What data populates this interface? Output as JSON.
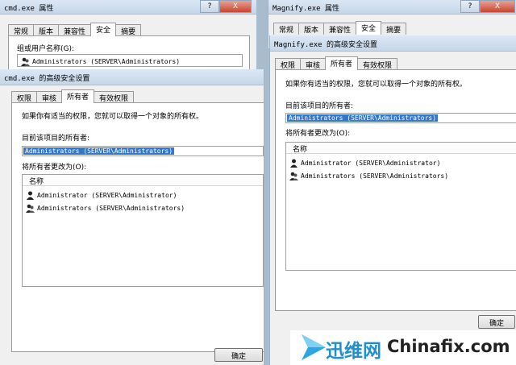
{
  "left_props": {
    "title": "cmd.exe 属性",
    "tabs": [
      "常规",
      "版本",
      "兼容性",
      "安全",
      "摘要"
    ],
    "active_tab": 3,
    "group_label": "组或用户名称(G):",
    "group_item": "Administrators (SERVER\\Administrators)"
  },
  "left_adv": {
    "title": "cmd.exe 的高级安全设置",
    "tabs": [
      "权限",
      "审核",
      "所有者",
      "有效权限"
    ],
    "active_tab": 2,
    "instruction": "如果你有适当的权限，您就可以取得一个对象的所有权。",
    "owner_label": "目前该项目的所有者:",
    "owner_value": "Administrators (SERVER\\Administrators)",
    "change_label": "将所有者更改为(O):",
    "list_header": "名称",
    "list_items": [
      "Administrator (SERVER\\Administrator)",
      "Administrators (SERVER\\Administrators)"
    ],
    "ok_button": "确定"
  },
  "right_props": {
    "title": "Magnify.exe 属性",
    "tabs": [
      "常规",
      "版本",
      "兼容性",
      "安全",
      "摘要"
    ],
    "active_tab": 3
  },
  "right_adv": {
    "title": "Magnify.exe 的高级安全设置",
    "tabs": [
      "权限",
      "审核",
      "所有者",
      "有效权限"
    ],
    "active_tab": 2,
    "instruction": "如果你有适当的权限，您就可以取得一个对象的所有权。",
    "owner_label": "目前该项目的所有者:",
    "owner_value": "Administrators (SERVER\\Administrators)",
    "change_label": "将所有者更改为(O):",
    "list_header": "名称",
    "list_items": [
      "Administrator (SERVER\\Administrator)",
      "Administrators (SERVER\\Administrators)"
    ],
    "ok_button": "确定"
  },
  "window_controls": {
    "help": "?",
    "close": "X"
  },
  "watermark": {
    "brand_cn": "迅维网",
    "brand_en": "Chinafix.com"
  }
}
